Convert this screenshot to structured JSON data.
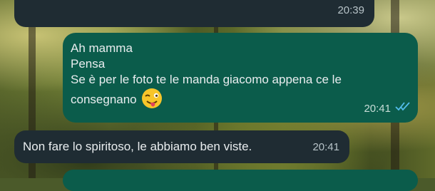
{
  "chat": {
    "messages": [
      {
        "direction": "incoming",
        "text": "",
        "time": "20:39"
      },
      {
        "direction": "outgoing",
        "lines": [
          "Ah mamma",
          "Pensa",
          "Se è per le foto te le manda giacomo appena ce le",
          "consegnano"
        ],
        "emoji": "winking-face-with-tongue-icon",
        "time": "20:41",
        "status": "read"
      },
      {
        "direction": "incoming",
        "text": "Non fare lo spiritoso, le abbiamo ben viste.",
        "time": "20:41"
      },
      {
        "direction": "outgoing",
        "text": ""
      }
    ]
  },
  "colors": {
    "incoming_bubble": "#1f2c33",
    "outgoing_bubble": "#0b5c4b",
    "read_checks": "#53bdeb"
  }
}
